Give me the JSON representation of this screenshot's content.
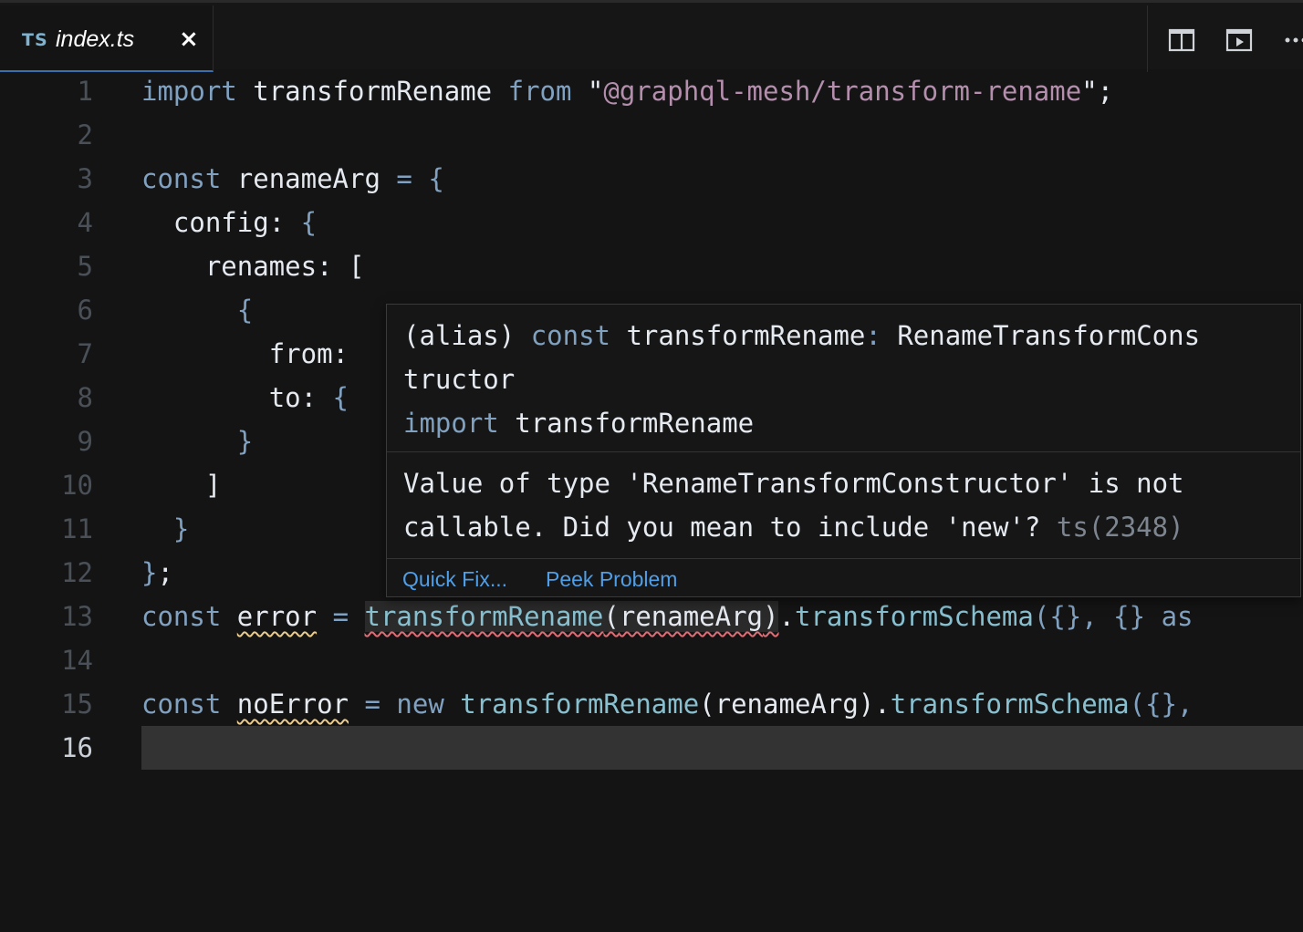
{
  "tab": {
    "language_badge": "TS",
    "filename": "index.ts",
    "close_glyph": "×"
  },
  "tab_actions": [
    {
      "icon": "split-editor-icon"
    },
    {
      "icon": "open-preview-icon"
    },
    {
      "icon": "more-actions-icon",
      "glyph": "···"
    }
  ],
  "gutter": [
    "1",
    "2",
    "3",
    "4",
    "5",
    "6",
    "7",
    "8",
    "9",
    "10",
    "11",
    "12",
    "13",
    "14",
    "15",
    "16"
  ],
  "code": {
    "l1": {
      "kw_import": "import",
      "ident": "transformRename",
      "kw_from": "from",
      "q1": "\"",
      "mod": "@graphql-mesh/transform-rename",
      "q2": "\"",
      "end": ";"
    },
    "l3": {
      "kw": "const",
      "ident": "renameArg",
      "eq": "=",
      "brace": "{"
    },
    "l4": {
      "key": "config:",
      "brace": "{"
    },
    "l5": {
      "key": "renames:",
      "bracket": "["
    },
    "l6": {
      "brace": "{"
    },
    "l7": {
      "key": "from:"
    },
    "l8": {
      "key": "to:",
      "brace": "{"
    },
    "l9": {
      "brace": "}"
    },
    "l10": {
      "bracket": "]"
    },
    "l11": {
      "brace": "}"
    },
    "l12": {
      "brace": "}",
      "end": ";"
    },
    "l13": {
      "kw": "const",
      "ident": "error",
      "eq": "=",
      "call": "transformRename",
      "paren_open": "(",
      "arg": "renameArg",
      "paren_close": ")",
      "dot": ".",
      "method": "transformSchema",
      "args": "({},",
      "obj": "{}",
      "as": "as"
    },
    "l15": {
      "kw": "const",
      "ident": "noError",
      "eq": "=",
      "kw_new": "new",
      "call": "transformRename",
      "paren_open": "(",
      "arg": "renameArg",
      "paren_close": ")",
      "dot": ".",
      "method": "transformSchema",
      "args": "({},"
    }
  },
  "hover": {
    "sig_alias": "(alias)",
    "sig_const": "const",
    "sig_name": "transformRename",
    "sig_colon": ":",
    "sig_type_a": "RenameTransformCons",
    "sig_type_b": "tructor",
    "sig_import_kw": "import",
    "sig_import_name": "transformRename",
    "message_line1": "Value of type 'RenameTransformConstructor' is not",
    "message_line2": "callable. Did you mean to include 'new'?",
    "code_ref": "ts(2348)",
    "quick_fix": "Quick Fix...",
    "peek_problem": "Peek Problem"
  },
  "colors": {
    "keyword": "#81a1c1",
    "function": "#88c0d0",
    "module_string": "#b48ead",
    "error_squiggle": "#e06c75",
    "warning_squiggle": "#ebcb8b",
    "link": "#4f9fe8"
  }
}
